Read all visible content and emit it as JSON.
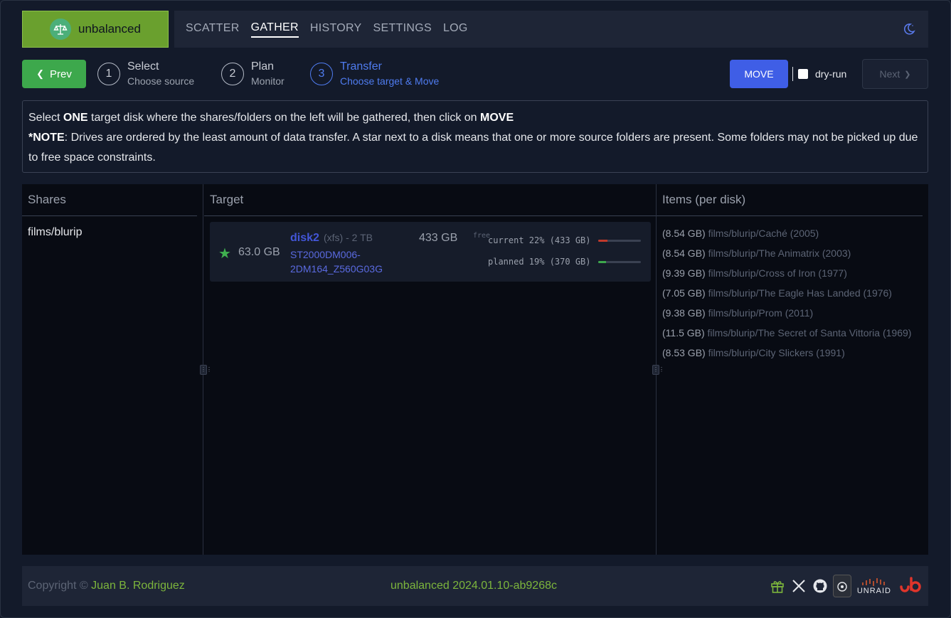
{
  "app": {
    "name": "unbalanced"
  },
  "nav": {
    "items": [
      "SCATTER",
      "GATHER",
      "HISTORY",
      "SETTINGS",
      "LOG"
    ],
    "active": "GATHER"
  },
  "wizard": {
    "prev_label": "Prev",
    "steps": [
      {
        "num": "1",
        "title": "Select",
        "sub": "Choose source"
      },
      {
        "num": "2",
        "title": "Plan",
        "sub": "Monitor"
      },
      {
        "num": "3",
        "title": "Transfer",
        "sub": "Choose target & Move"
      }
    ],
    "move_label": "MOVE",
    "dry_run_label": "dry-run",
    "dry_run_checked": false,
    "next_label": "Next"
  },
  "notice": {
    "line1_a": "Select ",
    "line1_b": "ONE",
    "line1_c": " target disk where the shares/folders on the left will be gathered, then click on ",
    "line1_d": "MOVE",
    "note_label": "*NOTE",
    "note_text": ": Drives are ordered by the least amount of data transfer. A star next to a disk means that one or more source folders are present. Some folders may not be picked up due to free space constraints."
  },
  "shares": {
    "title": "Shares",
    "items": [
      "films/blurip"
    ]
  },
  "target": {
    "title": "Target",
    "disk": {
      "transfer": "63.0 GB",
      "name": "disk2",
      "meta": "(xfs) - 2 TB",
      "serial_1": "ST2000DM006-",
      "serial_2": "2DM164_Z560G03G",
      "free": "433 GB",
      "free_label": "free",
      "current_label": "current 22% (433 GB)",
      "current_pct": 22,
      "planned_label": "planned 19% (370 GB)",
      "planned_pct": 19
    }
  },
  "items": {
    "title": "Items (per disk)",
    "list": [
      {
        "size": "(8.54 GB)",
        "path": "films/blurip/Caché (2005)"
      },
      {
        "size": "(8.54 GB)",
        "path": "films/blurip/The Animatrix (2003)"
      },
      {
        "size": "(9.39 GB)",
        "path": "films/blurip/Cross of Iron (1977)"
      },
      {
        "size": "(7.05 GB)",
        "path": "films/blurip/The Eagle Has Landed (1976)"
      },
      {
        "size": "(9.38 GB)",
        "path": "films/blurip/Prom (2011)"
      },
      {
        "size": "(11.5 GB)",
        "path": "films/blurip/The Secret of Santa Vittoria (1969)"
      },
      {
        "size": "(8.53 GB)",
        "path": "films/blurip/City Slickers (1991)"
      }
    ]
  },
  "footer": {
    "copyright": "Copyright © ",
    "author": "Juan B. Rodriguez",
    "version": "unbalanced 2024.01.10-ab9268c",
    "unraid": "UNRAID",
    "icons": [
      "gift-icon",
      "x-twitter-icon",
      "github-icon",
      "app-icon",
      "unraid-logo",
      "brand-logo"
    ]
  },
  "colors": {
    "accent": "#3f5ee6",
    "brand": "#6aa02e",
    "current_bar": "#c0392b",
    "planned_bar": "#3da84c"
  }
}
